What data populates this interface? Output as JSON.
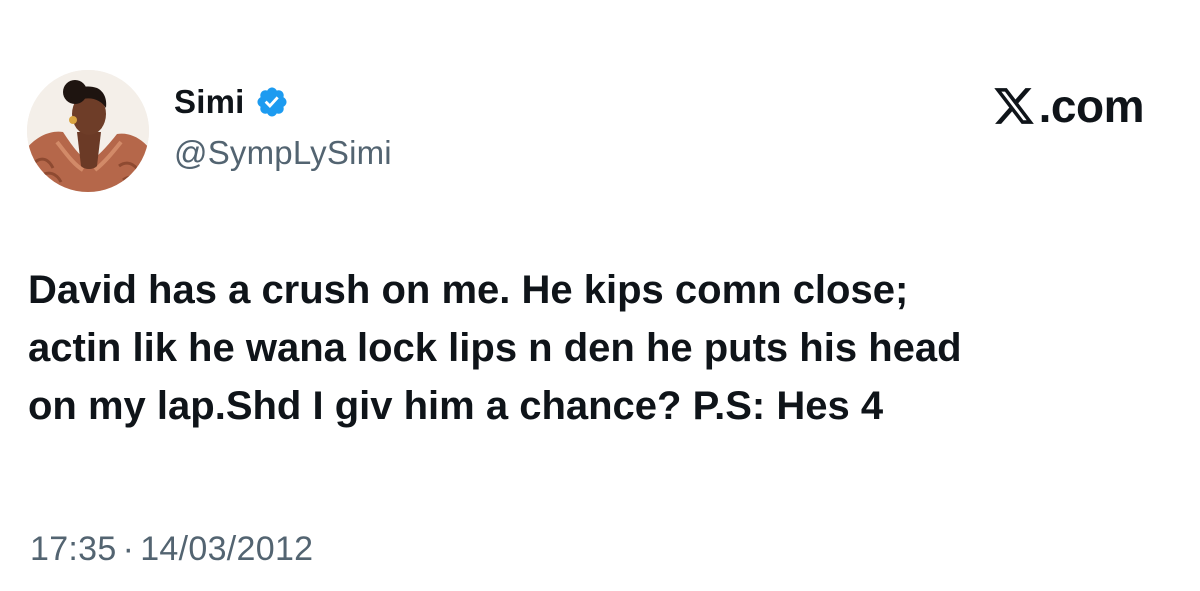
{
  "author": {
    "display_name": "Simi",
    "handle": "@SympLySimi",
    "verified": true,
    "avatar_icon": "profile-photo"
  },
  "brand": {
    "text": ".com",
    "logo_icon": "x-logo-icon"
  },
  "tweet": {
    "text": "David has a crush on me. He kips comn close;\nactin lik he wana lock lips n den he puts his head\non my lap.Shd I giv him a chance? P.S: Hes 4",
    "time": "17:35",
    "separator": "·",
    "date": "14/03/2012"
  },
  "colors": {
    "text_primary": "#0f1419",
    "text_secondary": "#536471",
    "verified_badge": "#1d9bf0",
    "background": "#ffffff"
  }
}
